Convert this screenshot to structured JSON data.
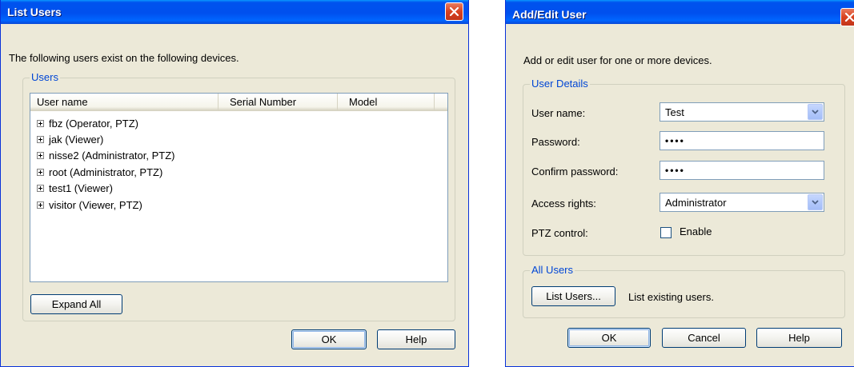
{
  "list_users": {
    "title": "List Users",
    "description": "The following users exist on the following devices.",
    "group_label": "Users",
    "columns": [
      "User name",
      "Serial Number",
      "Model"
    ],
    "rows": [
      "fbz (Operator, PTZ)",
      "jak (Viewer)",
      "nisse2 (Administrator, PTZ)",
      "root (Administrator, PTZ)",
      "test1 (Viewer)",
      "visitor (Viewer, PTZ)"
    ],
    "expand_all_label": "Expand All",
    "ok_label": "OK",
    "help_label": "Help"
  },
  "add_edit_user": {
    "title": "Add/Edit User",
    "description": "Add or edit user for one or more devices.",
    "user_details_label": "User Details",
    "user_name_label": "User name:",
    "user_name_value": "Test",
    "password_label": "Password:",
    "password_value": "••••",
    "confirm_password_label": "Confirm password:",
    "confirm_password_value": "••••",
    "access_rights_label": "Access rights:",
    "access_rights_value": "Administrator",
    "ptz_control_label": "PTZ control:",
    "enable_label": "Enable",
    "all_users_label": "All Users",
    "list_users_button": "List Users...",
    "list_users_desc": "List existing users.",
    "ok_label": "OK",
    "cancel_label": "Cancel",
    "help_label": "Help"
  },
  "colors": {
    "titlebar": "#0053ee",
    "window_bg": "#ece9d8",
    "group_legend": "#0046d5",
    "close_button": "#d8411f"
  },
  "icons": [
    "close-icon",
    "expand-plus-icon",
    "dropdown-arrow-icon"
  ]
}
